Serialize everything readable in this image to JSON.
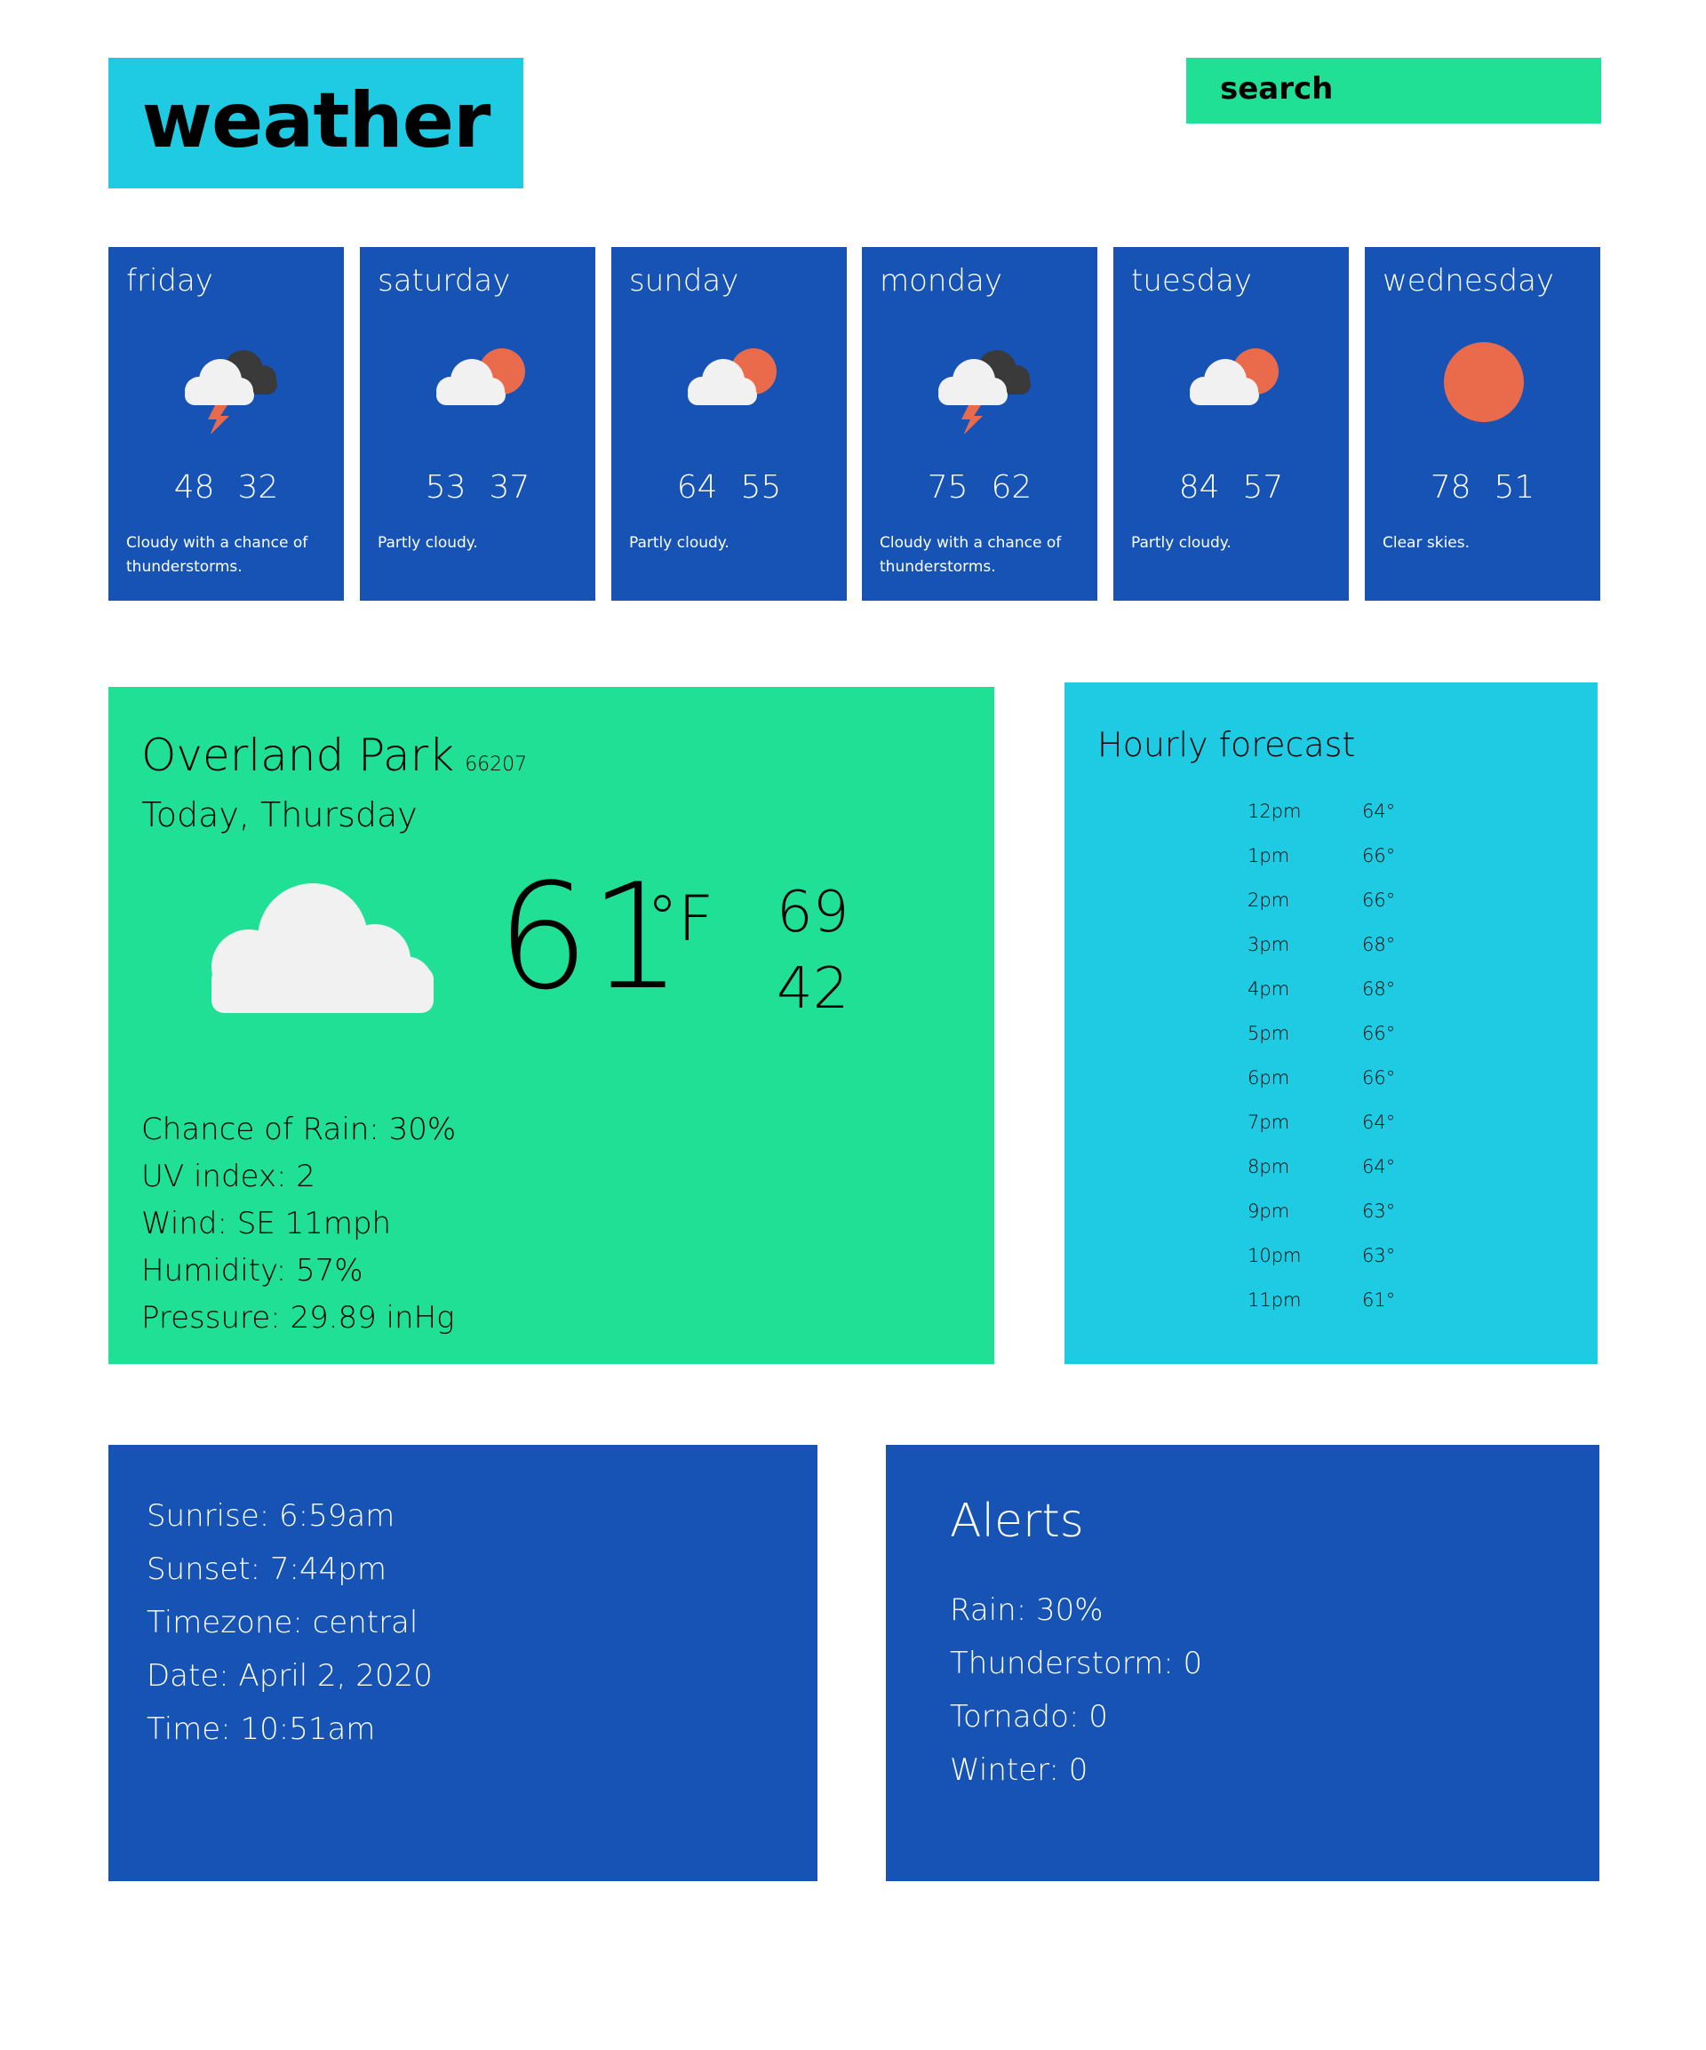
{
  "header": {
    "logo": "weather",
    "search_label": "search"
  },
  "forecast": [
    {
      "day": "friday",
      "high": "48",
      "low": "32",
      "desc": "Cloudy with a chance of thunderstorms.",
      "icon": "storm-cloud-icon"
    },
    {
      "day": "saturday",
      "high": "53",
      "low": "37",
      "desc": "Partly cloudy.",
      "icon": "partly-cloudy-icon"
    },
    {
      "day": "sunday",
      "high": "64",
      "low": "55",
      "desc": "Partly cloudy.",
      "icon": "partly-cloudy-icon"
    },
    {
      "day": "monday",
      "high": "75",
      "low": "62",
      "desc": "Cloudy with a chance of thunderstorms.",
      "icon": "storm-cloud-icon"
    },
    {
      "day": "tuesday",
      "high": "84",
      "low": "57",
      "desc": "Partly cloudy.",
      "icon": "partly-cloudy-icon"
    },
    {
      "day": "wednesday",
      "high": "78",
      "low": "51",
      "desc": "Clear skies.",
      "icon": "sun-icon"
    }
  ],
  "current": {
    "city": "Overland Park",
    "zip": "66207",
    "day": "Today, Thursday",
    "temp": "61",
    "unit": "°F",
    "high": "69",
    "low": "42",
    "icon": "cloud-icon",
    "details": [
      "Chance of Rain: 30%",
      "UV index:  2",
      "Wind:  SE 11mph",
      "Humidity:  57%",
      "Pressure:  29.89 inHg"
    ]
  },
  "hourly": {
    "title": "Hourly forecast",
    "rows": [
      {
        "hour": "12pm",
        "temp": "64°"
      },
      {
        "hour": "1pm",
        "temp": "66°"
      },
      {
        "hour": "2pm",
        "temp": "66°"
      },
      {
        "hour": "3pm",
        "temp": "68°"
      },
      {
        "hour": "4pm",
        "temp": "68°"
      },
      {
        "hour": "5pm",
        "temp": "66°"
      },
      {
        "hour": "6pm",
        "temp": "66°"
      },
      {
        "hour": "7pm",
        "temp": "64°"
      },
      {
        "hour": "8pm",
        "temp": "64°"
      },
      {
        "hour": "9pm",
        "temp": "63°"
      },
      {
        "hour": "10pm",
        "temp": "63°"
      },
      {
        "hour": "11pm",
        "temp": "61°"
      }
    ]
  },
  "sun": {
    "lines": [
      "Sunrise:  6:59am",
      "Sunset:  7:44pm",
      "Timezone:  central",
      "Date:  April 2, 2020",
      "Time:  10:51am"
    ]
  },
  "alerts": {
    "title": "Alerts",
    "lines": [
      "Rain:  30%",
      "Thunderstorm:  0",
      "Tornado:  0",
      "Winter:  0"
    ]
  },
  "colors": {
    "cyan": "#1ecbe2",
    "green": "#1fe095",
    "blue": "#1653b4",
    "sun": "#ea6b4c",
    "cloud": "#f1f1f1",
    "dark_cloud": "#3a3a3a"
  }
}
